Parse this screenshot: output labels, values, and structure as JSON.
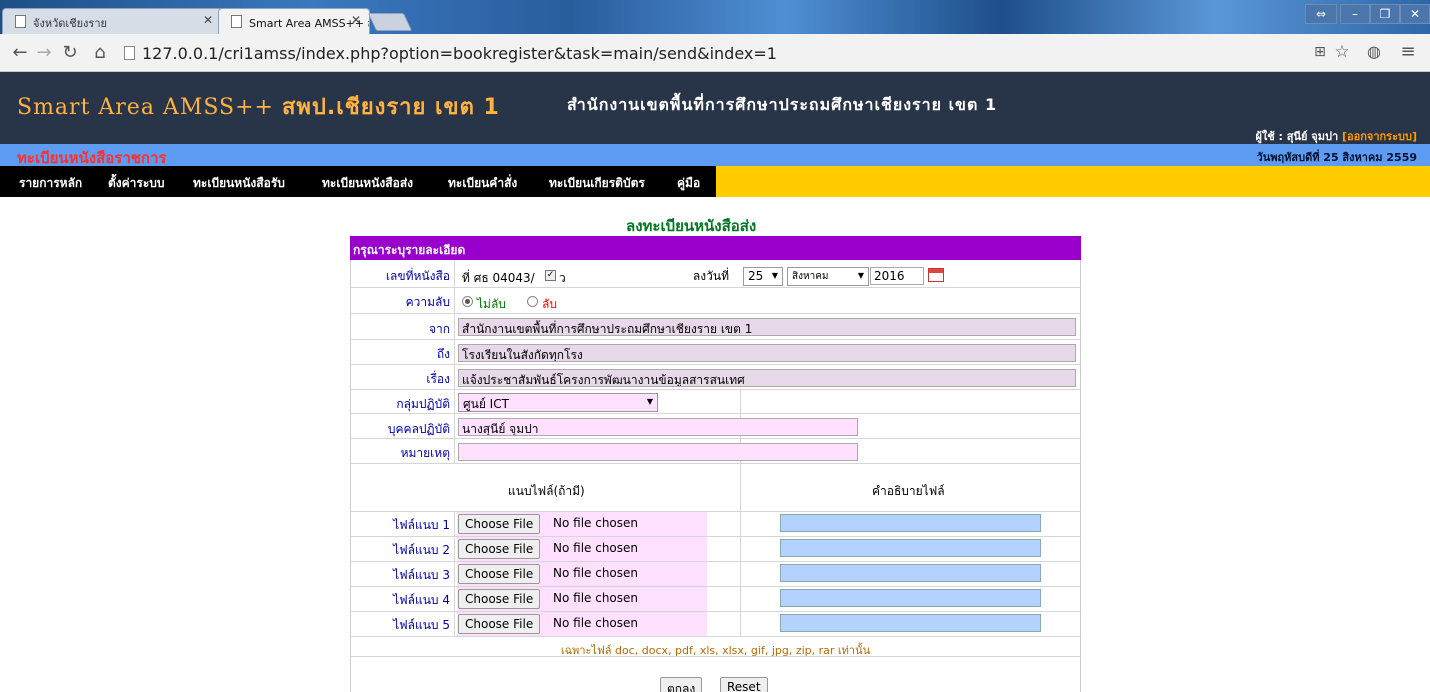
{
  "browser": {
    "tabs": [
      {
        "title": "จังหวัดเชียงราย"
      },
      {
        "title": "Smart Area AMSS++ สพป."
      }
    ],
    "url": "127.0.0.1/cri1amss/index.php?option=bookregister&task=main/send&index=1"
  },
  "header": {
    "title_latin": "Smart Area AMSS++",
    "title_thai": "สพป.เชียงราย เขต 1",
    "subtitle": "สำนักงานเขตพื้นที่การศึกษาประถมศึกษาเชียงราย เขต 1",
    "user_prefix": "ผู้ใช้ : สุนีย์ จุมปา",
    "logout_label": "[ออกจากระบบ]",
    "section_title": "ทะเบียนหนังสือราชการ",
    "date_text": "วันพฤหัสบดีที่ 25 สิงหาคม 2559"
  },
  "menu": [
    "รายการหลัก",
    "ตั้งค่าระบบ",
    "ทะเบียนหนังสือรับ",
    "ทะเบียนหนังสือส่ง",
    "ทะเบียนคำสั่ง",
    "ทะเบียนเกียรติบัตร",
    "คู่มือ"
  ],
  "form": {
    "title": "ลงทะเบียนหนังสือส่ง",
    "header": "กรุณาระบุรายละเอียด",
    "book_no_label": "เลขที่หนังสือ",
    "book_no_value": "ที่ ศธ 04043/",
    "book_no_suffix": "ว",
    "book_no_checked": true,
    "date_label": "ลงวันที่",
    "date_day": "25",
    "date_month": "สิงหาคม",
    "date_year": "2016",
    "secret_label": "ความลับ",
    "secret_options": [
      "ไม่ลับ",
      "ลับ"
    ],
    "secret_selected": "ไม่ลับ",
    "from_label": "จาก",
    "from_value": "สำนักงานเขตพื้นที่การศึกษาประถมศึกษาเชียงราย เขต 1",
    "to_label": "ถึง",
    "to_value": "โรงเรียนในสังกัดทุกโรง",
    "subject_label": "เรื่อง",
    "subject_value": "แจ้งประชาสัมพันธ์โครงการพัฒนางานข้อมูลสารสนเทศ",
    "group_label": "กลุ่มปฏิบัติ",
    "group_value": "ศูนย์ ICT",
    "person_label": "บุคคลปฏิบัติ",
    "person_value": "นางสุนีย์ จุมปา",
    "remark_label": "หมายเหตุ",
    "remark_value": "",
    "attach_header": "แนบไฟล์(ถ้ามี)",
    "desc_header": "คำอธิบายไฟล์",
    "files": [
      {
        "label": "ไฟล์แนบ 1",
        "button": "Choose File",
        "status": "No file chosen"
      },
      {
        "label": "ไฟล์แนบ 2",
        "button": "Choose File",
        "status": "No file chosen"
      },
      {
        "label": "ไฟล์แนบ 3",
        "button": "Choose File",
        "status": "No file chosen"
      },
      {
        "label": "ไฟล์แนบ 4",
        "button": "Choose File",
        "status": "No file chosen"
      },
      {
        "label": "ไฟล์แนบ 5",
        "button": "Choose File",
        "status": "No file chosen"
      }
    ],
    "file_note": "เฉพาะไฟล์ doc, docx, pdf, xls, xlsx, gif, jpg, zip, rar เท่านั้น",
    "submit_label": "ตกลง",
    "reset_label": "Reset"
  }
}
